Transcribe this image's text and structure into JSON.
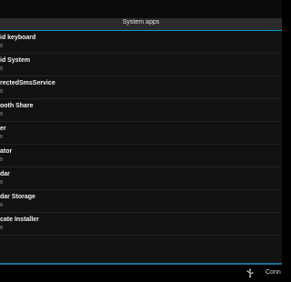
{
  "section": {
    "title": "System apps"
  },
  "apps": [
    {
      "name": "id keyboard",
      "size": "B"
    },
    {
      "name": "id System",
      "size": "B"
    },
    {
      "name": "rectedSmsService",
      "size": "B"
    },
    {
      "name": "ooth Share",
      "size": "B"
    },
    {
      "name": "er",
      "size": "B"
    },
    {
      "name": "ator",
      "size": "B"
    },
    {
      "name": "dar",
      "size": "B"
    },
    {
      "name": "dar Storage",
      "size": "B"
    },
    {
      "name": "cate Installer",
      "size": "B"
    }
  ],
  "statusbar": {
    "text": "Conn",
    "icon": "usb-icon"
  }
}
